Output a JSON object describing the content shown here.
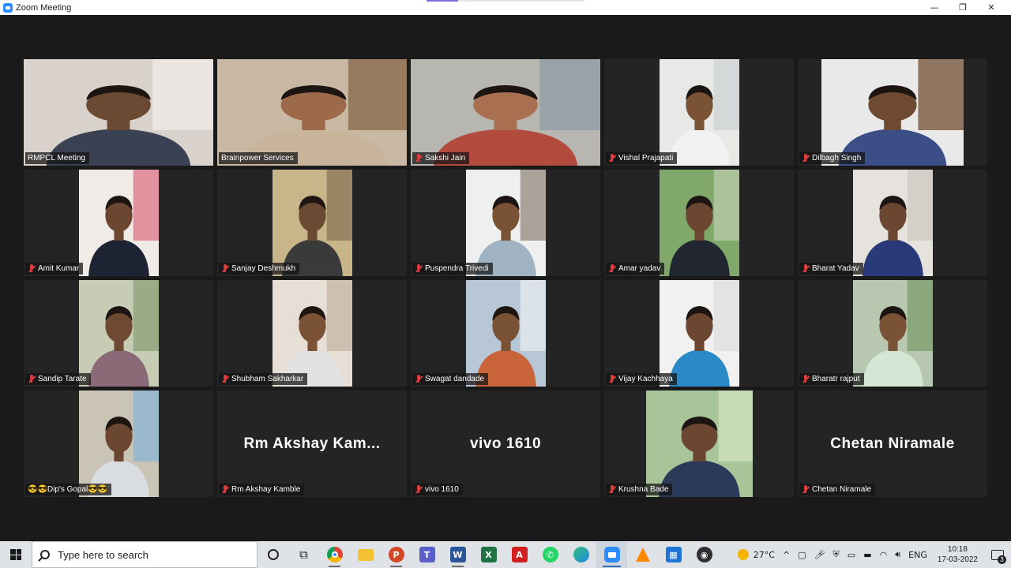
{
  "window": {
    "title": "Zoom Meeting",
    "minimize": "—",
    "maximize": "❐",
    "close": "✕"
  },
  "participants": [
    {
      "name": "RMPCL Meeting",
      "muted": false,
      "video": true,
      "active": false
    },
    {
      "name": "Brainpower Services",
      "muted": false,
      "video": true,
      "active": true
    },
    {
      "name": "Sakshi Jain",
      "muted": true,
      "video": true,
      "active": false
    },
    {
      "name": "Vishal Prajapati",
      "muted": true,
      "video": true,
      "active": false
    },
    {
      "name": "Dilbagh Singh",
      "muted": true,
      "video": true,
      "active": false
    },
    {
      "name": "Amit Kumar",
      "muted": true,
      "video": true,
      "active": false
    },
    {
      "name": "Sanjay Deshmukh",
      "muted": true,
      "video": true,
      "active": false
    },
    {
      "name": "Puspendra Trivedi",
      "muted": true,
      "video": true,
      "active": false
    },
    {
      "name": "Amar yadav",
      "muted": true,
      "video": true,
      "active": false
    },
    {
      "name": "Bharat Yadav",
      "muted": true,
      "video": true,
      "active": false
    },
    {
      "name": "Sandip Tarate",
      "muted": true,
      "video": true,
      "active": false
    },
    {
      "name": "Shubham Sakharkar",
      "muted": true,
      "video": true,
      "active": false
    },
    {
      "name": "Swagat dandade",
      "muted": true,
      "video": true,
      "active": false
    },
    {
      "name": "Vijay Kachhaya",
      "muted": true,
      "video": true,
      "active": false
    },
    {
      "name": "Bharatr rajput",
      "muted": true,
      "video": true,
      "active": false
    },
    {
      "name": "😎😎Dip's Gopal😎😎",
      "muted": false,
      "video": true,
      "active": false
    },
    {
      "name": "Rm Akshay Kamble",
      "display_name": "Rm Akshay Kam...",
      "muted": true,
      "video": false,
      "active": false
    },
    {
      "name": "vivo 1610",
      "display_name": "vivo 1610",
      "muted": true,
      "video": false,
      "active": false
    },
    {
      "name": "Krushna Bade",
      "muted": true,
      "video": true,
      "active": false
    },
    {
      "name": "Chetan Niramale",
      "display_name": "Chetan Niramale",
      "muted": true,
      "video": false,
      "active": false
    }
  ],
  "taskbar": {
    "search_placeholder": "Type here to search",
    "apps": [
      "task-view",
      "cortana",
      "chrome",
      "file-explorer",
      "powerpoint",
      "teams",
      "word",
      "excel",
      "acrobat",
      "whatsapp",
      "edge",
      "zoom",
      "vlc",
      "calendar",
      "obs"
    ],
    "weather": "27°C",
    "language": "ENG",
    "time": "10:18",
    "date": "17-03-2022",
    "notifications": "3"
  }
}
